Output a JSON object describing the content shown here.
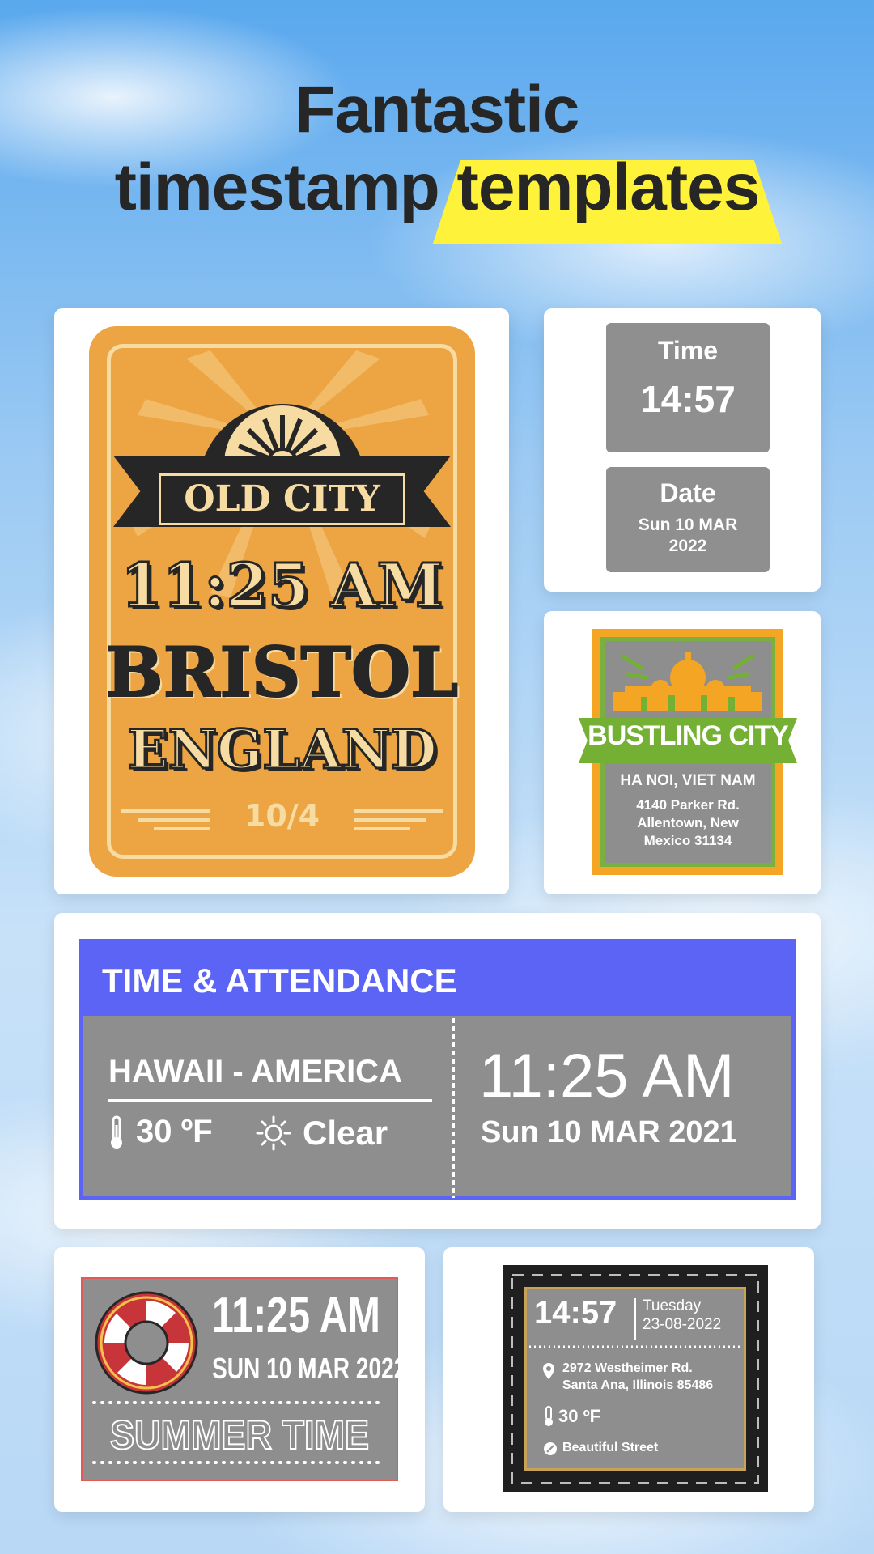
{
  "header": {
    "title_line1": "Fantastic",
    "title_line2_part1": "timestamp",
    "title_line2_highlight": "templates"
  },
  "old_city": {
    "badge": "OLD CITY",
    "time": "11:25 AM",
    "city": "BRISTOL",
    "country": "ENGLAND",
    "date": "10/4"
  },
  "time_date": {
    "time_label": "Time",
    "time_value": "14:57",
    "date_label": "Date",
    "date_value_line1": "Sun 10 MAR",
    "date_value_line2": "2022"
  },
  "bustling": {
    "banner": "BUSTLING CITY",
    "location": "HA NOI, VIET NAM",
    "address_line1": "4140 Parker Rd.",
    "address_line2": "Allentown, New",
    "address_line3": "Mexico 31134"
  },
  "attendance": {
    "heading": "TIME & ATTENDANCE",
    "place": "HAWAII - AMERICA",
    "temperature": "30 ºF",
    "weather": "Clear",
    "time": "11:25 AM",
    "date": "Sun 10 MAR 2021"
  },
  "summer": {
    "time": "11:25 AM",
    "date": "SUN 10 MAR 2022",
    "caption": "SUMMER TIME"
  },
  "dark": {
    "time": "14:57",
    "day": "Tuesday",
    "date": "23-08-2022",
    "address_line1": "2972 Westheimer Rd.",
    "address_line2": "Santa Ana, Illinois 85486",
    "temperature": "30 ºF",
    "street": "Beautiful Street"
  },
  "colors": {
    "highlight": "#fff23a",
    "old_city_orange": "#eda442",
    "attendance_blue": "#5b64f5",
    "bustling_green": "#74b033",
    "bustling_orange": "#f5a524"
  }
}
